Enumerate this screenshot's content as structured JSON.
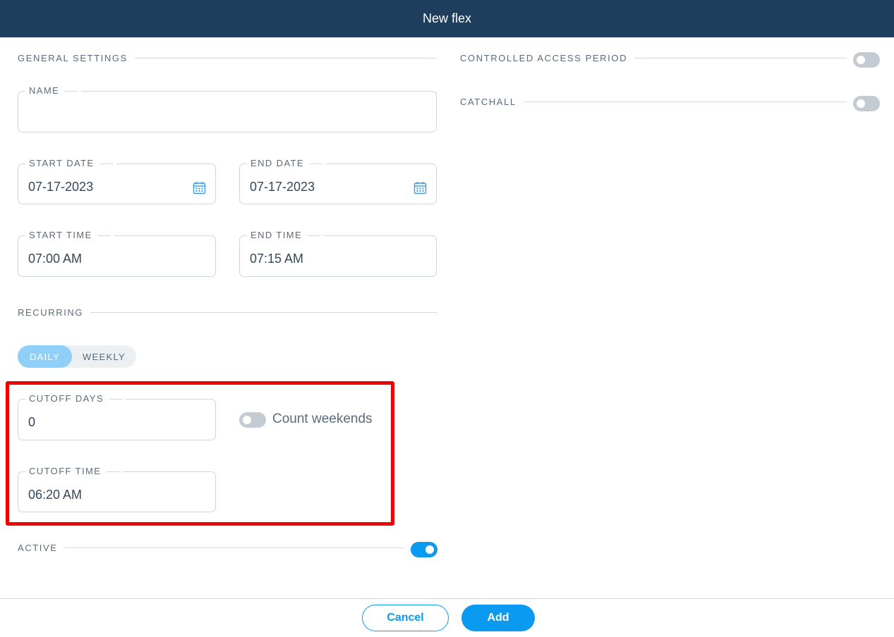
{
  "dialog": {
    "title": "New flex"
  },
  "general": {
    "section_label": "GENERAL SETTINGS",
    "name": {
      "label": "NAME",
      "value": ""
    },
    "start_date": {
      "label": "START DATE",
      "value": "07-17-2023",
      "icon": "calendar-icon"
    },
    "end_date": {
      "label": "END DATE",
      "value": "07-17-2023",
      "icon": "calendar-icon"
    },
    "start_time": {
      "label": "START TIME",
      "value": "07:00 AM"
    },
    "end_time": {
      "label": "END TIME",
      "value": "07:15 AM"
    }
  },
  "recurring": {
    "section_label": "RECURRING",
    "options": [
      "DAILY",
      "WEEKLY"
    ],
    "selected": "DAILY",
    "cutoff_days": {
      "label": "CUTOFF DAYS",
      "value": "0"
    },
    "cutoff_time": {
      "label": "CUTOFF TIME",
      "value": "06:20 AM"
    },
    "count_weekends": {
      "label": "Count weekends",
      "enabled": false
    }
  },
  "active": {
    "label": "ACTIVE",
    "enabled": true
  },
  "controlled_access_period": {
    "label": "CONTROLLED ACCESS PERIOD",
    "enabled": false
  },
  "catchall": {
    "label": "CATCHALL",
    "enabled": false
  },
  "footer": {
    "cancel_label": "Cancel",
    "add_label": "Add"
  },
  "colors": {
    "header": "#1f3d5c",
    "accent": "#0a9af0",
    "highlight": "#f00000"
  }
}
